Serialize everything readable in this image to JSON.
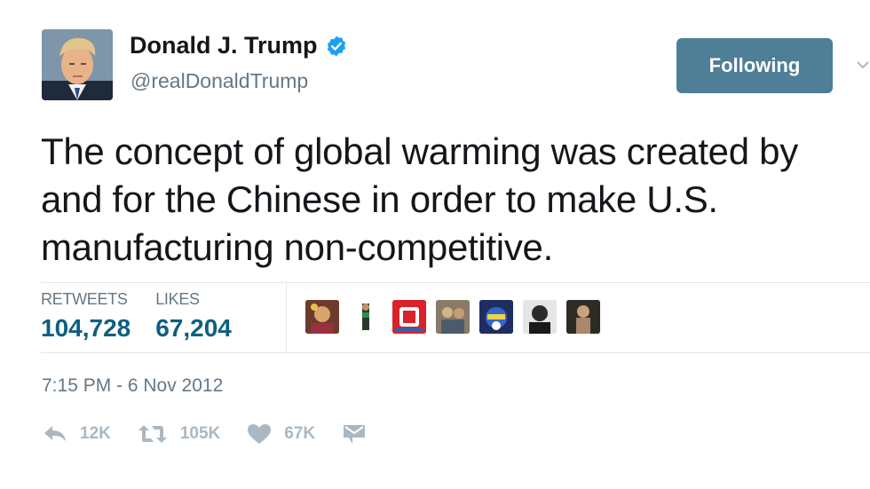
{
  "author": {
    "display_name": "Donald J. Trump",
    "handle": "@realDonaldTrump",
    "avatar_icon": "profile-photo",
    "verified_icon": "verified-badge-icon"
  },
  "follow_button": {
    "label": "Following"
  },
  "tweet": {
    "text": "The concept of global warming was created by and for the Chinese in order to make U.S. manufacturing non-competitive."
  },
  "stats": [
    {
      "label": "RETWEETS",
      "value": "104,728"
    },
    {
      "label": "LIKES",
      "value": "67,204"
    }
  ],
  "likers": [
    "liker-avatar",
    "liker-avatar",
    "liker-avatar",
    "liker-avatar",
    "liker-avatar",
    "liker-avatar",
    "liker-avatar"
  ],
  "timestamp": "7:15 PM - 6 Nov 2012",
  "actions": {
    "reply": {
      "icon": "reply-icon",
      "count": "12K"
    },
    "retweet": {
      "icon": "retweet-icon",
      "count": "105K"
    },
    "like": {
      "icon": "heart-icon",
      "count": "67K"
    },
    "message": {
      "icon": "direct-message-icon"
    }
  },
  "colors": {
    "follow_button_bg": "#4e7f96",
    "stat_value": "#0e5f80",
    "verified": "#1da1f2",
    "muted_text": "#657786",
    "action_icon": "#aab8c2"
  }
}
